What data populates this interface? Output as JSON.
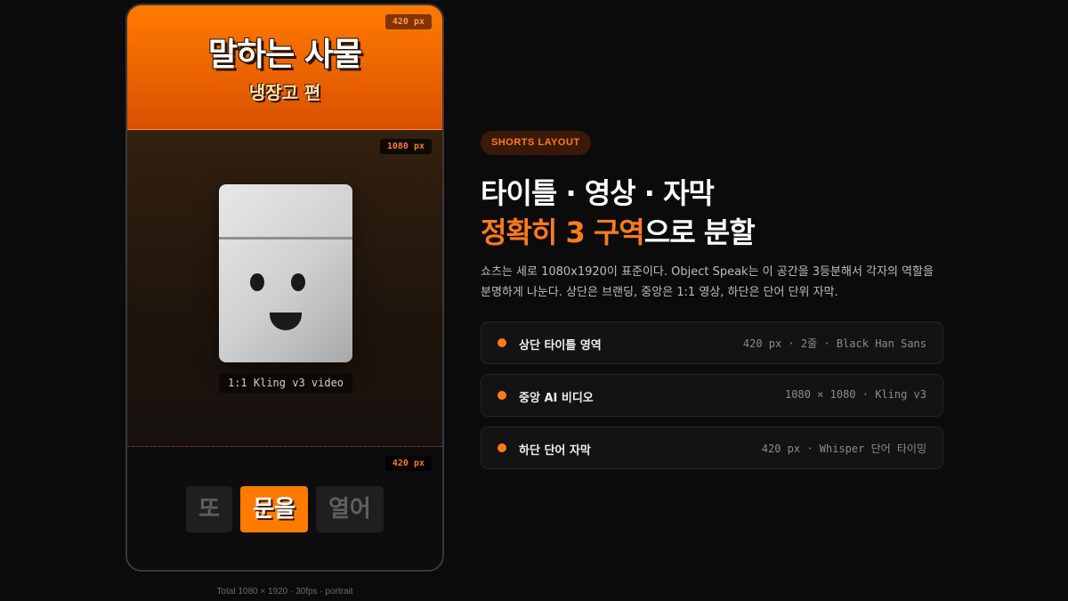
{
  "phone": {
    "title": {
      "main": "말하는 사물",
      "sub": "냉장고 편",
      "badge": "420 px"
    },
    "video": {
      "badge": "1080 px",
      "caption": "1:1 Kling v3 video"
    },
    "subtitles": {
      "badge": "420 px",
      "words": [
        "또",
        "문을",
        "열어"
      ],
      "active_index": 1
    },
    "total": "Total   1080 × 1920 · 30fps · portrait"
  },
  "info": {
    "pill": "SHORTS LAYOUT",
    "heading_line1": "타이틀 · 영상 · 자막",
    "heading_line2_highlight": "정확히 3 구역",
    "heading_line2_rest": "으로 분할",
    "description": "쇼츠는 세로 1080x1920이 표준이다. Object Speak는 이 공간을 3등분해서 각자의 역할을 분명하게 나눈다. 상단은 브랜딩, 중앙은 1:1 영상, 하단은 단어 단위 자막.",
    "rows": [
      {
        "label": "상단 타이틀 영역",
        "meta": "420 px · 2줄 · Black Han Sans"
      },
      {
        "label": "중앙 AI 비디오",
        "meta": "1080 × 1080 · Kling v3"
      },
      {
        "label": "하단 단어 자막",
        "meta": "420 px · Whisper 단어 타이밍"
      }
    ]
  },
  "colors": {
    "accent": "#ff7a1a",
    "background": "#0b0b0b",
    "title_gradient_top": "#ff7a00",
    "title_gradient_bottom": "#d95000"
  }
}
